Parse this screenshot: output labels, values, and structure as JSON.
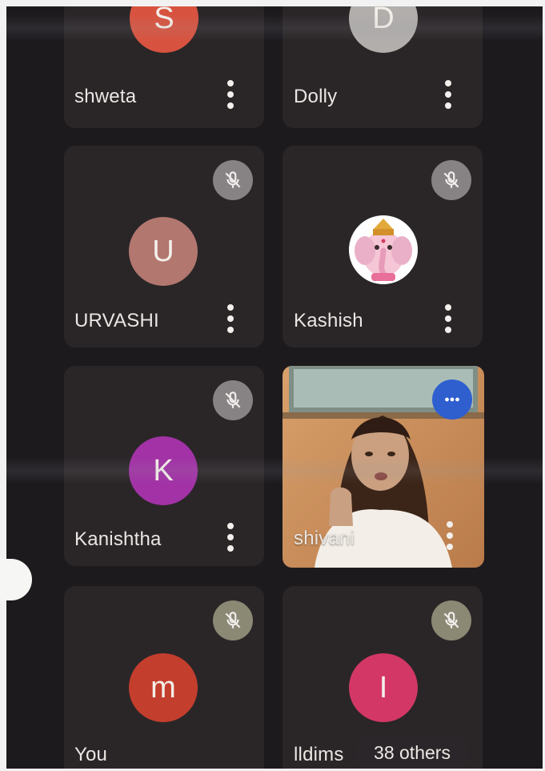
{
  "participants": [
    {
      "name": "shweta",
      "initial": "S",
      "color": "#d8533f",
      "muted": false
    },
    {
      "name": "Dolly",
      "initial": "D",
      "color": "#b1aeac",
      "muted": false
    },
    {
      "name": "URVASHI",
      "initial": "U",
      "color": "#b2776f",
      "muted": true
    },
    {
      "name": "Kashish",
      "initial": "",
      "color": "#ffffff",
      "muted": true,
      "avatar_icon": "ganesha-icon"
    },
    {
      "name": "Kanishtha",
      "initial": "K",
      "color": "#a232a6",
      "muted": true
    },
    {
      "name": "shivani",
      "initial": "",
      "color": "#c69360",
      "muted": false,
      "video": true,
      "speaking": true
    },
    {
      "name": "You",
      "initial": "m",
      "color": "#c43e2d",
      "muted": true
    },
    {
      "name": "lldims",
      "initial": "I",
      "color": "#d33765",
      "muted": true
    }
  ],
  "overflow": {
    "label": "38 others"
  },
  "icons": {
    "more": "more-vert-icon",
    "mute": "mic-off-icon",
    "speaking": "speaking-dots-icon"
  },
  "colors": {
    "background": "#1d1a1e",
    "tile": "#2a2628",
    "speaking_badge": "#2f5fcf"
  }
}
